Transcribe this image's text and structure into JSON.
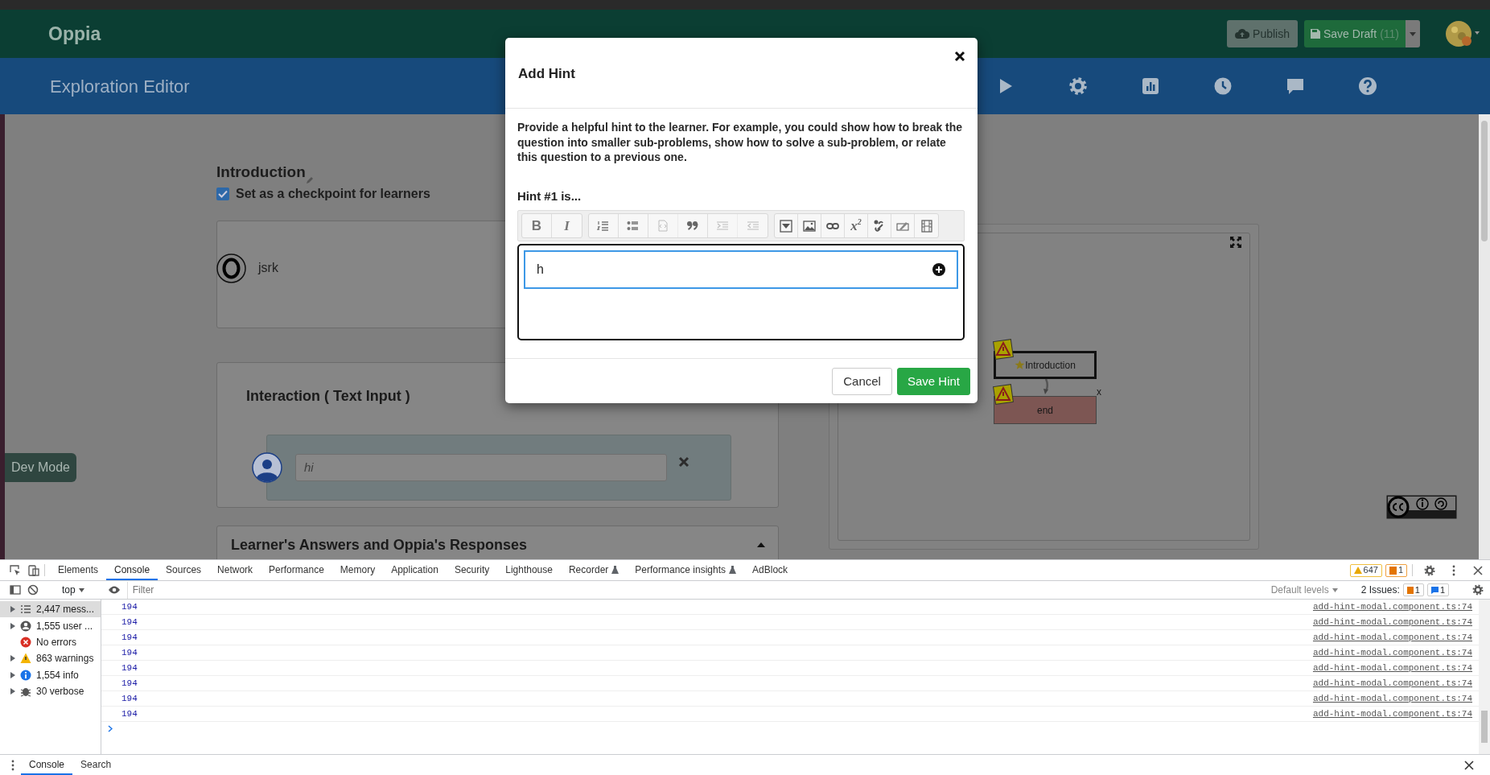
{
  "top_nav": {
    "logo": "Oppia",
    "publish_label": "Publish",
    "save_draft_label": "Save Draft",
    "draft_changes": "(11)"
  },
  "editor_header": {
    "title": "Exploration Editor"
  },
  "state": {
    "title": "Introduction",
    "checkpoint": {
      "label": "Set as a checkpoint for learners",
      "checked": true
    },
    "content_author": "jsrk",
    "interaction_title": "Interaction ( Text Input )",
    "answer_placeholder": "hi",
    "responses_title": "Learner's Answers and Oppia's Responses"
  },
  "graph": {
    "nodes": [
      {
        "label": "Introduction",
        "kind": "initial"
      },
      {
        "label": "end",
        "kind": "terminal",
        "delete_mark": "x"
      }
    ]
  },
  "dev_mode": "Dev Mode",
  "modal": {
    "title": "Add Hint",
    "description": "Provide a helpful hint to the learner. For example, you could show how to break the question into smaller sub-problems, show how to solve a sub-problem, or relate this question to a previous one.",
    "hint_label": "Hint #1 is...",
    "hint_value": "h",
    "toolbar": [
      [
        {
          "kind": "bold",
          "label": "B",
          "disabled": false
        },
        {
          "kind": "italic",
          "label": "I",
          "disabled": false
        }
      ],
      [
        {
          "kind": "ordered-list",
          "disabled": false
        },
        {
          "kind": "bullet-list",
          "disabled": false
        },
        {
          "kind": "code",
          "disabled": true
        },
        {
          "kind": "quote",
          "disabled": false
        },
        {
          "kind": "indent",
          "disabled": true
        },
        {
          "kind": "outdent",
          "disabled": true
        }
      ],
      [
        {
          "kind": "collapsible",
          "disabled": false
        },
        {
          "kind": "image",
          "disabled": false
        },
        {
          "kind": "link",
          "disabled": false
        },
        {
          "kind": "math",
          "label": "x",
          "sup": "2",
          "disabled": false
        },
        {
          "kind": "skill",
          "disabled": false
        },
        {
          "kind": "tabs",
          "disabled": false
        },
        {
          "kind": "video",
          "disabled": false
        }
      ]
    ],
    "buttons": [
      {
        "label": "Cancel",
        "kind": "secondary"
      },
      {
        "label": "Save Hint",
        "kind": "primary"
      }
    ]
  },
  "devtools": {
    "tabs": [
      {
        "label": "Elements",
        "selected": false
      },
      {
        "label": "Console",
        "selected": true
      },
      {
        "label": "Sources",
        "selected": false
      },
      {
        "label": "Network",
        "selected": false
      },
      {
        "label": "Performance",
        "selected": false
      },
      {
        "label": "Memory",
        "selected": false
      },
      {
        "label": "Application",
        "selected": false
      },
      {
        "label": "Security",
        "selected": false
      },
      {
        "label": "Lighthouse",
        "selected": false
      },
      {
        "label": "Recorder",
        "selected": false,
        "experimental": true
      },
      {
        "label": "Performance insights",
        "selected": false,
        "experimental": true
      },
      {
        "label": "AdBlock",
        "selected": false
      }
    ],
    "warnings_count": "647",
    "errors_count": "1",
    "context": "top",
    "filter_placeholder": "Filter",
    "levels": "Default levels",
    "issues_label": "2 Issues:",
    "issue_warnings": "1",
    "issue_info": "1",
    "sidebar": [
      {
        "label": "2,447 mess...",
        "kind": "messages",
        "expandable": true,
        "selected": true
      },
      {
        "label": "1,555 user ...",
        "kind": "user",
        "expandable": true,
        "selected": false
      },
      {
        "label": "No errors",
        "kind": "errors",
        "expandable": false,
        "selected": false
      },
      {
        "label": "863 warnings",
        "kind": "warnings",
        "expandable": true,
        "selected": false
      },
      {
        "label": "1,554 info",
        "kind": "info",
        "expandable": true,
        "selected": false
      },
      {
        "label": "30 verbose",
        "kind": "verbose",
        "expandable": true,
        "selected": false
      }
    ],
    "logs": [
      {
        "text": "194",
        "source": "add-hint-modal.component.ts:74"
      },
      {
        "text": "194",
        "source": "add-hint-modal.component.ts:74"
      },
      {
        "text": "194",
        "source": "add-hint-modal.component.ts:74"
      },
      {
        "text": "194",
        "source": "add-hint-modal.component.ts:74"
      },
      {
        "text": "194",
        "source": "add-hint-modal.component.ts:74"
      },
      {
        "text": "194",
        "source": "add-hint-modal.component.ts:74"
      },
      {
        "text": "194",
        "source": "add-hint-modal.component.ts:74"
      },
      {
        "text": "194",
        "source": "add-hint-modal.component.ts:74"
      }
    ],
    "drawer_tabs": [
      {
        "label": "Console",
        "selected": true
      },
      {
        "label": "Search",
        "selected": false
      }
    ]
  }
}
